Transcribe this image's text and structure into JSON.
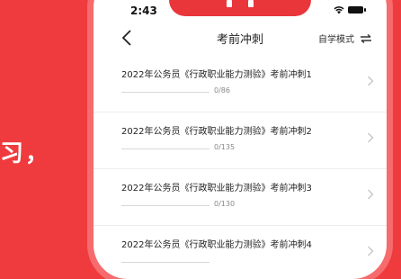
{
  "background": {
    "accent": "#ef3b3e",
    "text_fragment": "习，"
  },
  "status_bar": {
    "time": "2:43"
  },
  "nav": {
    "title": "考前冲刺",
    "mode_label": "自学模式"
  },
  "items": [
    {
      "title": "2022年公务员《行政职业能力测验》考前冲刺1",
      "count": "0/86",
      "progress": 0
    },
    {
      "title": "2022年公务员《行政职业能力测验》考前冲刺2",
      "count": "0/135",
      "progress": 0
    },
    {
      "title": "2022年公务员《行政职业能力测验》考前冲刺3",
      "count": "0/130",
      "progress": 0
    },
    {
      "title": "2022年公务员《行政职业能力测验》考前冲刺4",
      "count": "",
      "progress": 0
    }
  ],
  "icons": [
    "back-icon",
    "swap-icon",
    "chevron-right-icon",
    "wifi-icon",
    "battery-icon"
  ]
}
